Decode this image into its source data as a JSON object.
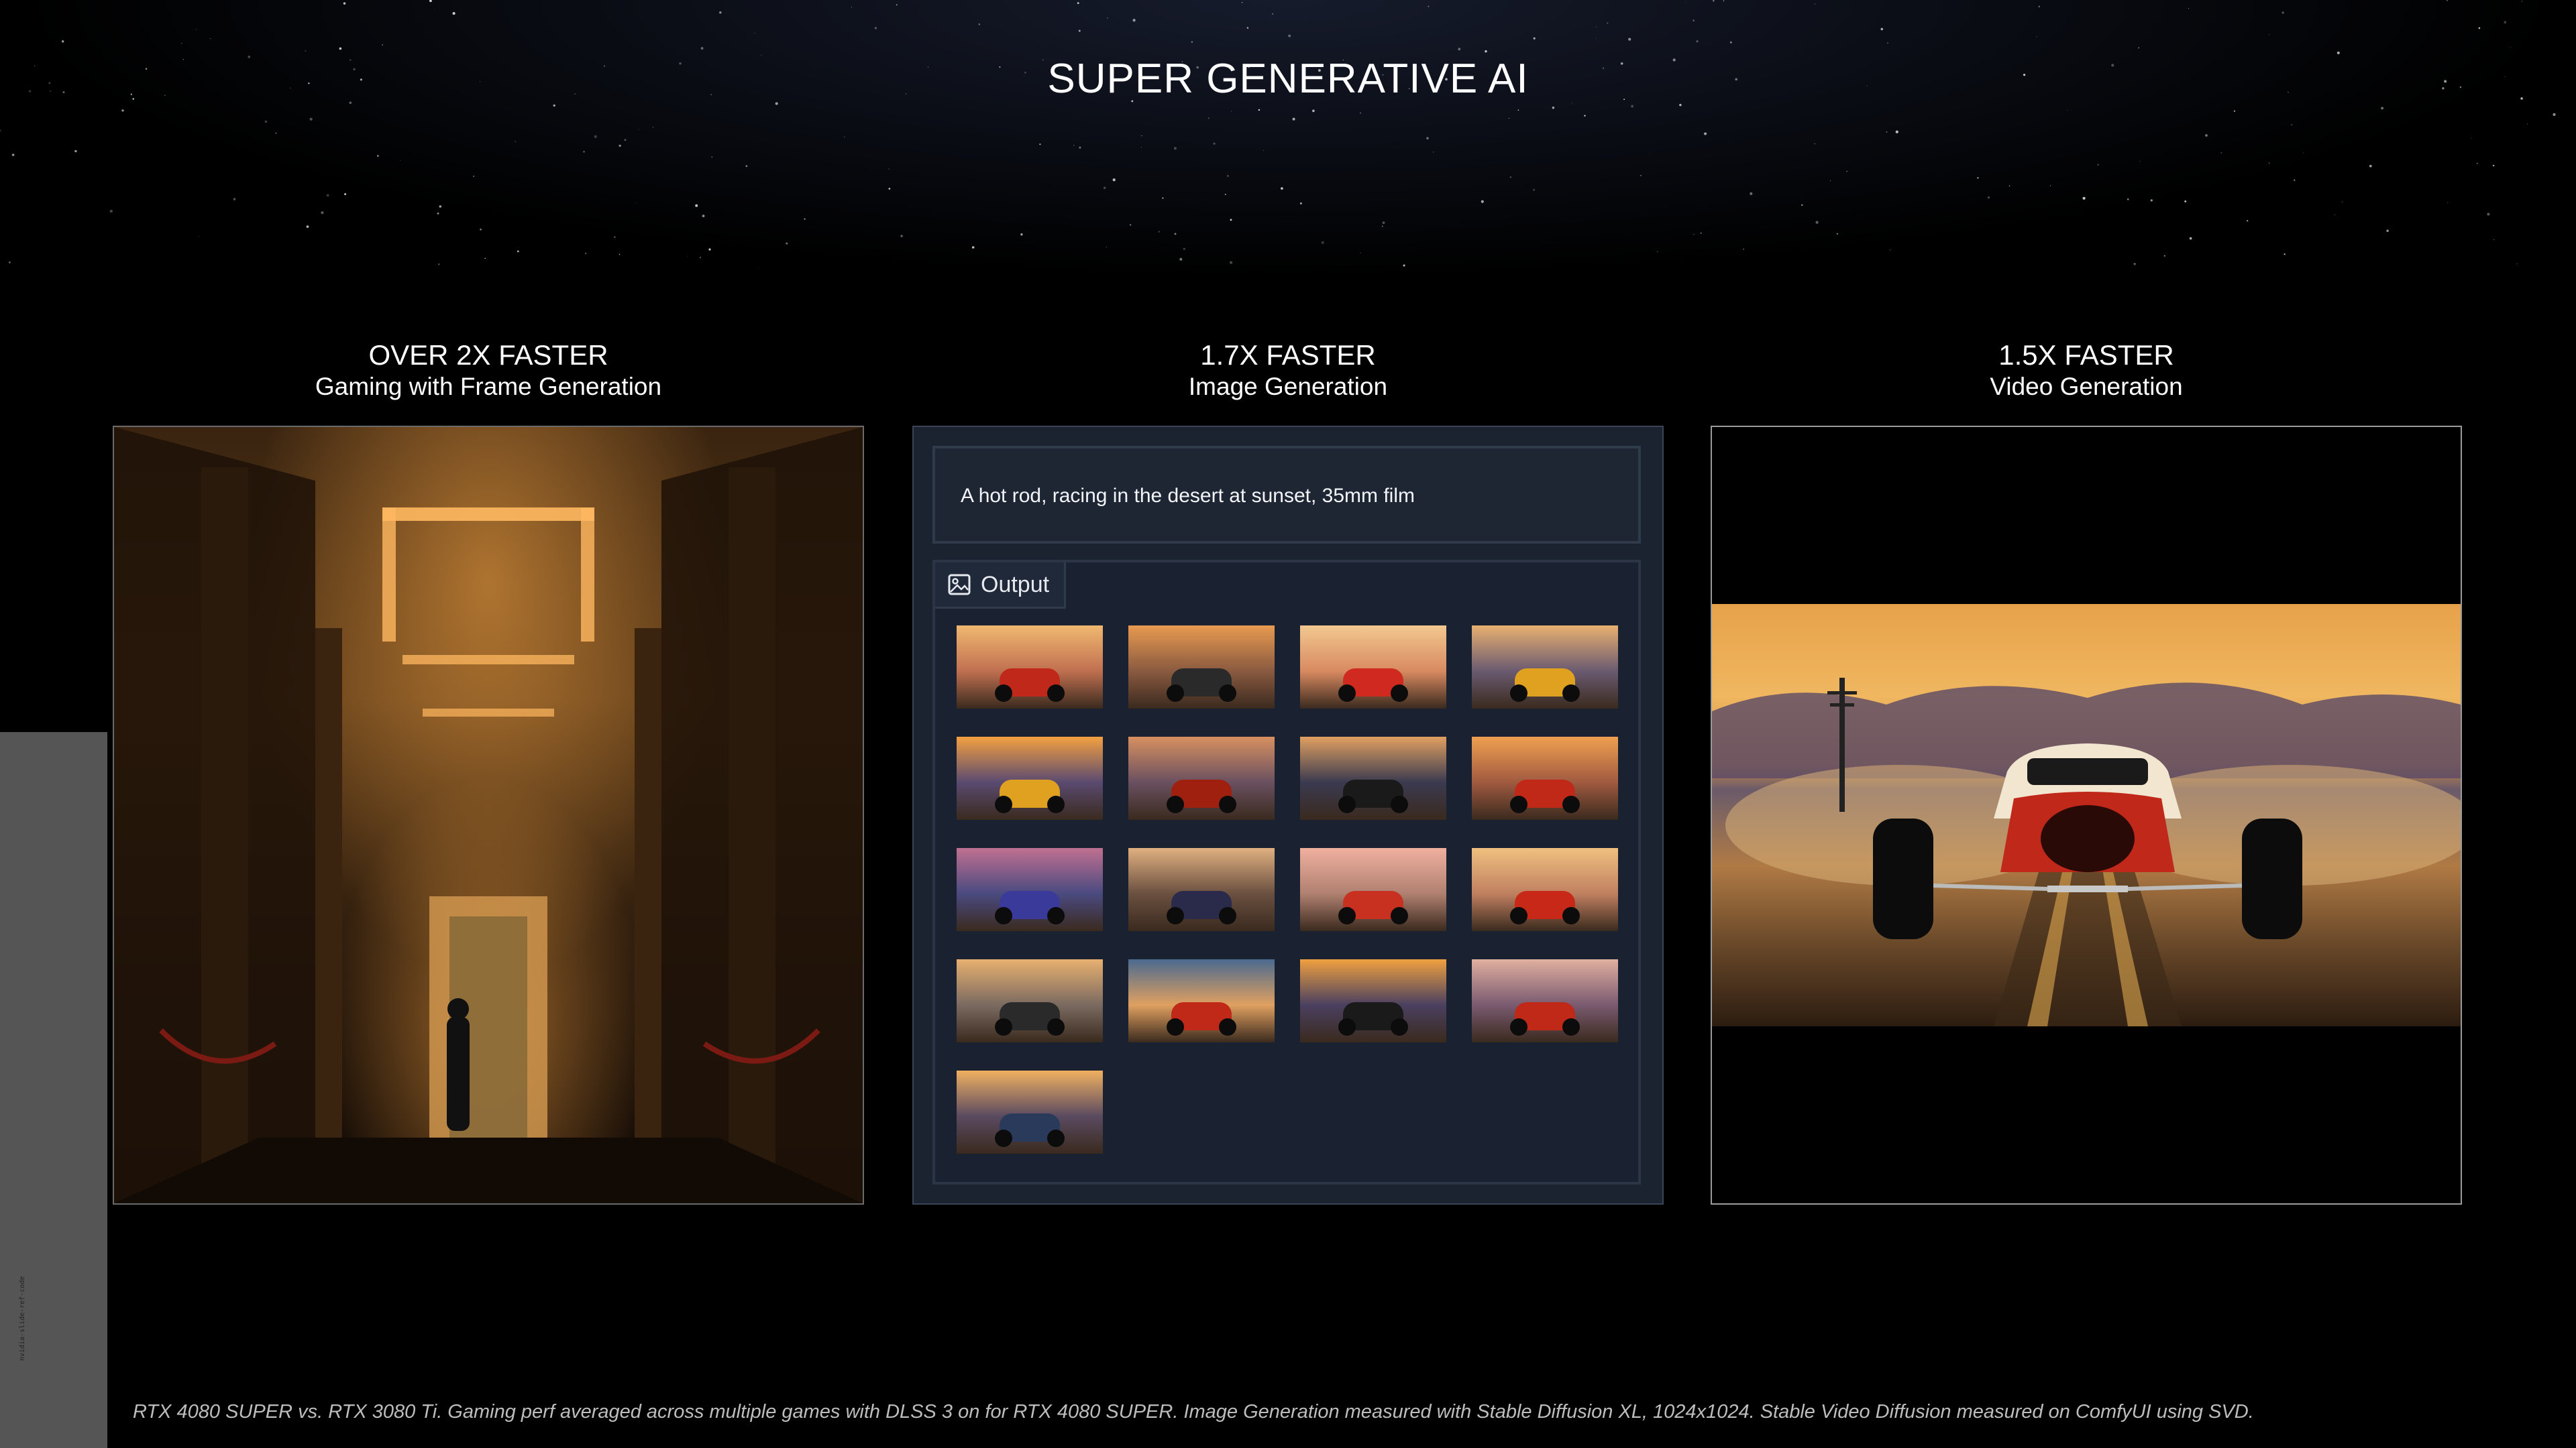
{
  "slide": {
    "title": "SUPER GENERATIVE AI",
    "side_code": "nvidia-slide-ref-code",
    "footnote": "RTX 4080 SUPER vs. RTX 3080 Ti.  Gaming perf averaged across multiple games with DLSS 3 on for RTX 4080 SUPER. Image Generation measured with Stable Diffusion XL, 1024x1024.  Stable Video Diffusion measured on ComfyUI using SVD."
  },
  "columns": [
    {
      "stat": "OVER 2X FASTER",
      "subtitle": "Gaming with Frame Generation"
    },
    {
      "stat": "1.7X FASTER",
      "subtitle": "Image Generation"
    },
    {
      "stat": "1.5X FASTER",
      "subtitle": "Video Generation"
    }
  ],
  "image_gen": {
    "prompt": "A hot rod, racing in the desert at sunset, 35mm film",
    "output_tab_label": "Output",
    "output_icon": "image-icon",
    "thumbnail_count": 17
  },
  "colors": {
    "background": "#000000",
    "ui_panel": "#1c2330",
    "ui_border": "#2f3a4b",
    "footnote_text": "#bdbdbd"
  }
}
